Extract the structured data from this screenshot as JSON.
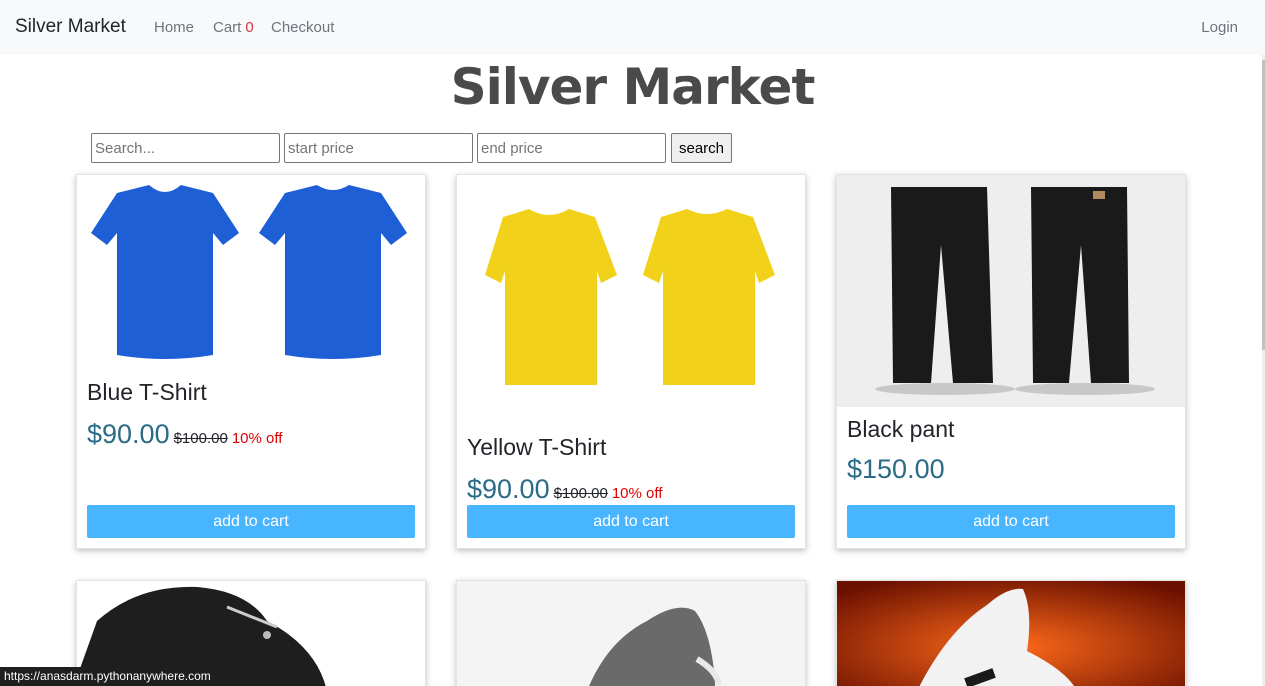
{
  "nav": {
    "brand": "Silver Market",
    "home": "Home",
    "cart": "Cart",
    "cart_count": "0",
    "checkout": "Checkout",
    "login": "Login"
  },
  "title": "Silver Market",
  "search": {
    "query_placeholder": "Search...",
    "start_placeholder": "start price",
    "end_placeholder": "end price",
    "button": "search"
  },
  "products": [
    {
      "name": "Blue T-Shirt",
      "price": "$90.00",
      "old_price": "$100.00",
      "discount": "10% off",
      "button": "add to cart",
      "image": "blue-tshirt-image",
      "color": "#1f5fd6"
    },
    {
      "name": "Yellow T-Shirt",
      "price": "$90.00",
      "old_price": "$100.00",
      "discount": "10% off",
      "button": "add to cart",
      "image": "yellow-tshirt-image",
      "color": "#f2d11a"
    },
    {
      "name": "Black pant",
      "price": "$150.00",
      "button": "add to cart",
      "image": "black-pant-image",
      "color": "#1a1a1a"
    },
    {
      "name": "",
      "image": "black-shoe-image"
    },
    {
      "name": "",
      "image": "grey-sneaker-image"
    },
    {
      "name": "",
      "image": "white-sneaker-image"
    }
  ],
  "status_url": "https://anasdarm.pythonanywhere.com",
  "colors": {
    "accent_button": "#47b5ff",
    "price": "#2a6b86",
    "discount": "#e00000",
    "cart_count": "#dc3545"
  }
}
